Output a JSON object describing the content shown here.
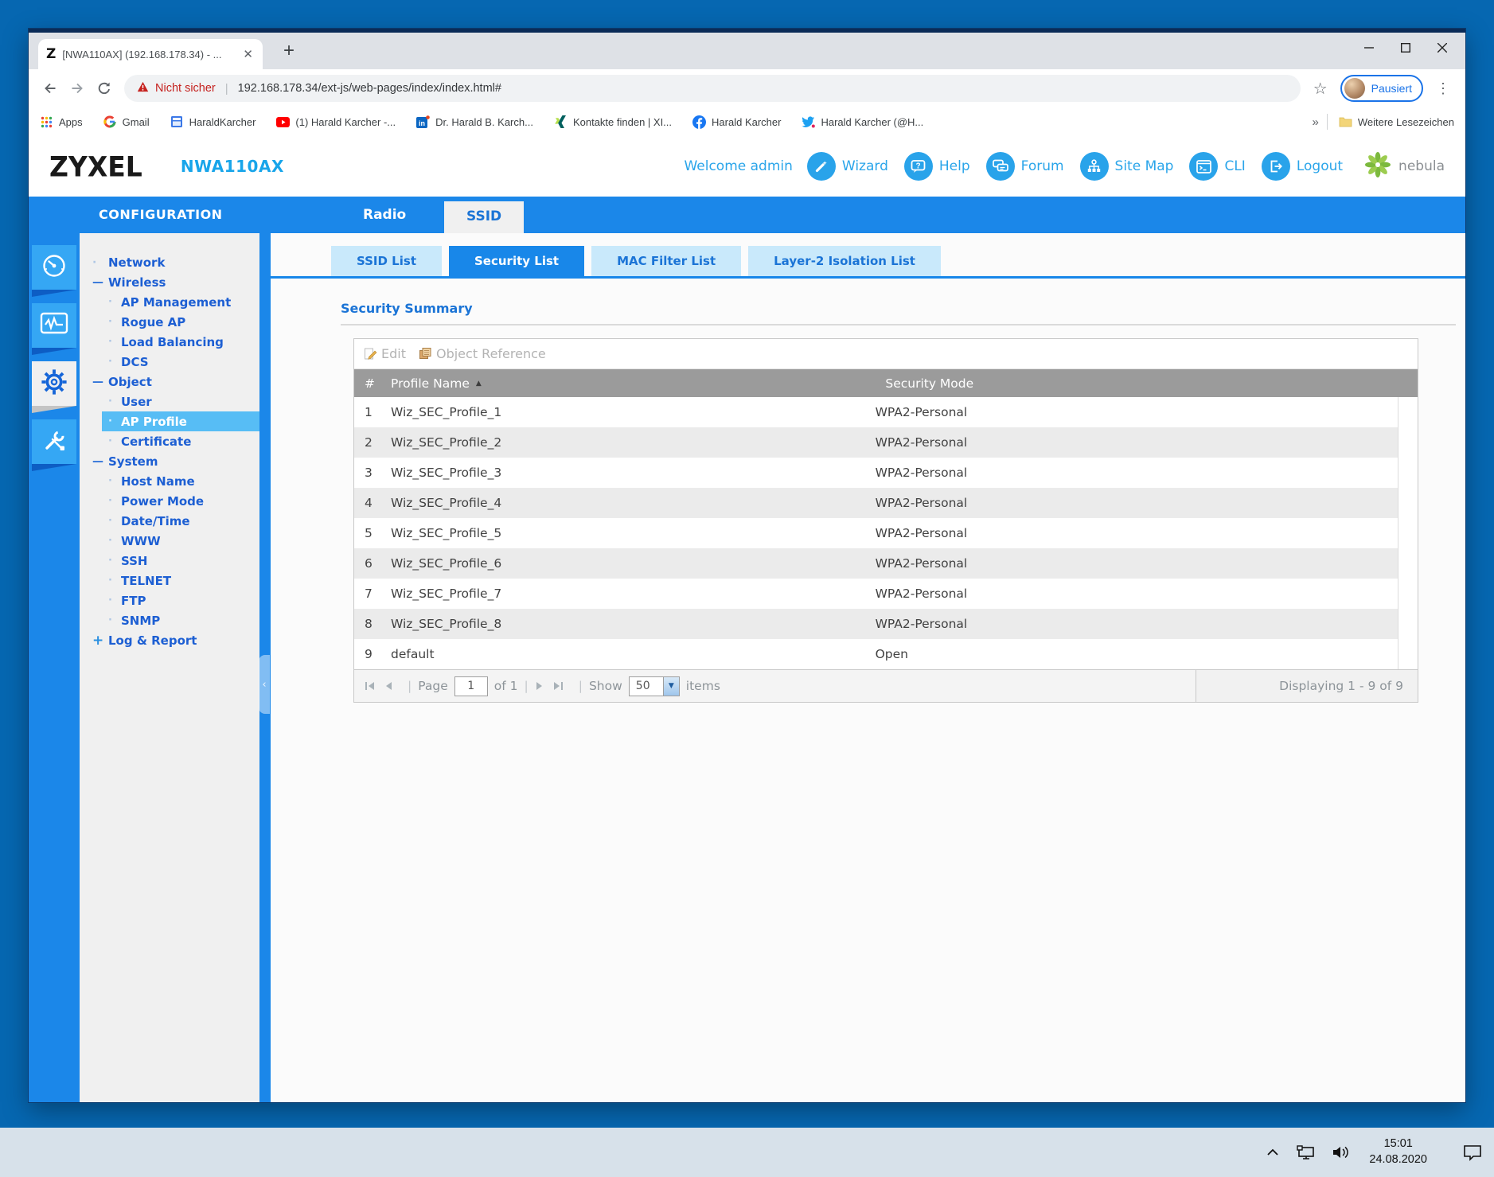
{
  "colors": {
    "accent_blue": "#1b87e9",
    "menu_blue": "#1d5fd3",
    "light_blue_tab": "#c9e9fb",
    "header_link_blue": "#2aa5ea",
    "table_header_gray": "#9b9b9b",
    "warning_red": "#c5221f",
    "highlight_blue": "#57bdf5"
  },
  "taskbar": {
    "time": "15:01",
    "date": "24.08.2020"
  },
  "browser": {
    "tab_title": "[NWA110AX] (192.168.178.34) - ...",
    "security_label": "Nicht sicher",
    "url": "192.168.178.34/ext-js/web-pages/index/index.html#",
    "profile_label": "Pausiert",
    "bookmarks": [
      {
        "label": "Apps",
        "icon": "apps-grid-icon"
      },
      {
        "label": "Gmail",
        "icon": "google-g-icon"
      },
      {
        "label": "HaraldKarcher",
        "icon": "blue-window-icon"
      },
      {
        "label": "(1) Harald Karcher -...",
        "icon": "youtube-icon"
      },
      {
        "label": "Dr. Harald B. Karch...",
        "icon": "linkedin-icon"
      },
      {
        "label": "Kontakte finden | XI...",
        "icon": "xing-icon"
      },
      {
        "label": "Harald Karcher",
        "icon": "facebook-icon"
      },
      {
        "label": "Harald Karcher (@H...",
        "icon": "twitter-icon"
      }
    ],
    "bookmarks_overflow": "»",
    "more_bookmarks": "Weitere Lesezeichen"
  },
  "app": {
    "brand": "ZYXEL",
    "model": "NWA110AX",
    "welcome": "Welcome admin",
    "header_links": [
      {
        "label": "Wizard"
      },
      {
        "label": "Help"
      },
      {
        "label": "Forum"
      },
      {
        "label": "Site Map"
      },
      {
        "label": "CLI"
      },
      {
        "label": "Logout"
      }
    ],
    "nebula_label": "nebula",
    "config_label": "CONFIGURATION",
    "top_tabs": [
      {
        "label": "Radio"
      },
      {
        "label": "SSID"
      }
    ],
    "sidebar": [
      {
        "label": "Network",
        "marker": "·"
      },
      {
        "label": "Wireless",
        "marker": "—"
      },
      {
        "label": "AP Management",
        "marker": "·"
      },
      {
        "label": "Rogue AP",
        "marker": "·"
      },
      {
        "label": "Load Balancing",
        "marker": "·"
      },
      {
        "label": "DCS",
        "marker": "·"
      },
      {
        "label": "Object",
        "marker": "—"
      },
      {
        "label": "User",
        "marker": "·"
      },
      {
        "label": "AP Profile",
        "marker": "·"
      },
      {
        "label": "Certificate",
        "marker": "·"
      },
      {
        "label": "System",
        "marker": "—"
      },
      {
        "label": "Host Name",
        "marker": "·"
      },
      {
        "label": "Power Mode",
        "marker": "·"
      },
      {
        "label": "Date/Time",
        "marker": "·"
      },
      {
        "label": "WWW",
        "marker": "·"
      },
      {
        "label": "SSH",
        "marker": "·"
      },
      {
        "label": "TELNET",
        "marker": "·"
      },
      {
        "label": "FTP",
        "marker": "·"
      },
      {
        "label": "SNMP",
        "marker": "·"
      },
      {
        "label": "Log & Report",
        "marker": "+"
      }
    ],
    "subtabs": [
      {
        "label": "SSID List"
      },
      {
        "label": "Security List"
      },
      {
        "label": "MAC Filter List"
      },
      {
        "label": "Layer-2 Isolation List"
      }
    ],
    "section_title": "Security Summary",
    "toolbar": {
      "edit": "Edit",
      "object_reference": "Object Reference"
    },
    "table": {
      "columns": [
        "#",
        "Profile Name",
        "Security Mode"
      ],
      "sort_indicator": "▲",
      "rows": [
        [
          "1",
          "Wiz_SEC_Profile_1",
          "WPA2-Personal"
        ],
        [
          "2",
          "Wiz_SEC_Profile_2",
          "WPA2-Personal"
        ],
        [
          "3",
          "Wiz_SEC_Profile_3",
          "WPA2-Personal"
        ],
        [
          "4",
          "Wiz_SEC_Profile_4",
          "WPA2-Personal"
        ],
        [
          "5",
          "Wiz_SEC_Profile_5",
          "WPA2-Personal"
        ],
        [
          "6",
          "Wiz_SEC_Profile_6",
          "WPA2-Personal"
        ],
        [
          "7",
          "Wiz_SEC_Profile_7",
          "WPA2-Personal"
        ],
        [
          "8",
          "Wiz_SEC_Profile_8",
          "WPA2-Personal"
        ],
        [
          "9",
          "default",
          "Open"
        ]
      ]
    },
    "pagination": {
      "page_label": "Page",
      "page_value": "1",
      "of_label": "of 1",
      "show_label": "Show",
      "show_value": "50",
      "items_label": "items",
      "displaying": "Displaying 1 - 9 of 9"
    }
  }
}
